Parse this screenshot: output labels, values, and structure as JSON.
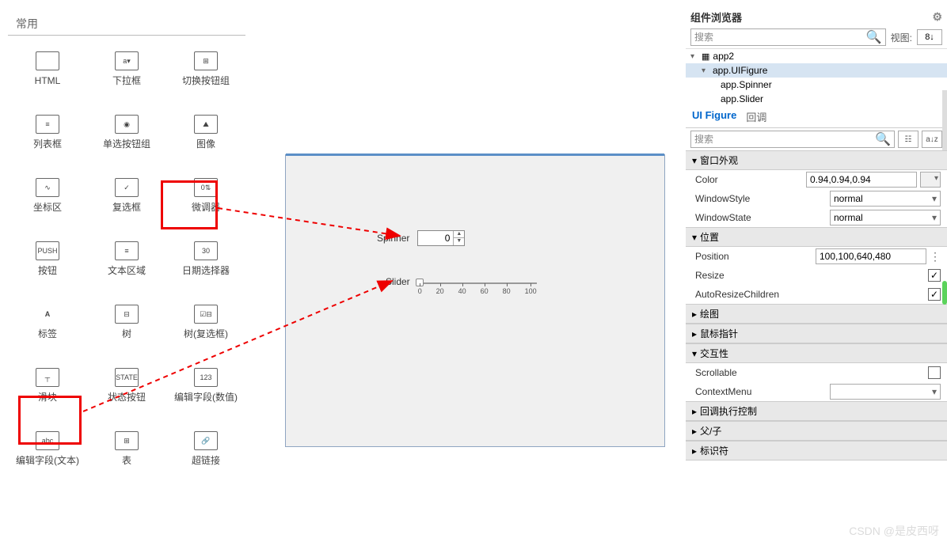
{
  "palette": {
    "header": "常用",
    "items": [
      {
        "label": "HTML",
        "icon": "</>"
      },
      {
        "label": "下拉框",
        "icon": "a▾"
      },
      {
        "label": "切换按钮组",
        "icon": "⊞"
      },
      {
        "label": "列表框",
        "icon": "≡"
      },
      {
        "label": "单选按钮组",
        "icon": "◉"
      },
      {
        "label": "图像",
        "icon": "⛰"
      },
      {
        "label": "坐标区",
        "icon": "∿"
      },
      {
        "label": "复选框",
        "icon": "✓"
      },
      {
        "label": "微调器",
        "icon": "0⇅"
      },
      {
        "label": "按钮",
        "icon": "PUSH"
      },
      {
        "label": "文本区域",
        "icon": "≡"
      },
      {
        "label": "日期选择器",
        "icon": "30"
      },
      {
        "label": "标签",
        "icon": "A"
      },
      {
        "label": "树",
        "icon": "⊟"
      },
      {
        "label": "树(复选框)",
        "icon": "☑⊟"
      },
      {
        "label": "滑块",
        "icon": "┬"
      },
      {
        "label": "状态按钮",
        "icon": "STATE"
      },
      {
        "label": "编辑字段(数值)",
        "icon": "123"
      },
      {
        "label": "编辑字段(文本)",
        "icon": "abc"
      },
      {
        "label": "表",
        "icon": "⊞"
      },
      {
        "label": "超链接",
        "icon": "🔗"
      }
    ]
  },
  "canvas": {
    "spinner": {
      "label": "Spinner",
      "value": "0"
    },
    "slider": {
      "label": "Slider",
      "ticks": [
        "0",
        "20",
        "40",
        "60",
        "80",
        "100"
      ]
    }
  },
  "browser": {
    "title": "组件浏览器",
    "search_placeholder": "搜索",
    "view_label": "视图:",
    "view_value": "8↓",
    "tree": {
      "root": "app2",
      "items": [
        "app.UIFigure",
        "app.Spinner",
        "app.Slider"
      ]
    },
    "tabs": {
      "uifigure": "UI Figure",
      "callback": "回调"
    },
    "prop_search_placeholder": "搜索",
    "sections": {
      "window": "窗口外观",
      "position": "位置",
      "plot": "绘图",
      "pointer": "鼠标指针",
      "interact": "交互性",
      "callback_ctrl": "回调执行控制",
      "parent": "父/子",
      "ident": "标识符"
    },
    "props": {
      "color": {
        "name": "Color",
        "value": "0.94,0.94,0.94"
      },
      "winstyle": {
        "name": "WindowStyle",
        "value": "normal"
      },
      "winstate": {
        "name": "WindowState",
        "value": "normal"
      },
      "position": {
        "name": "Position",
        "value": "100,100,640,480"
      },
      "resize": {
        "name": "Resize",
        "checked": true
      },
      "auto": {
        "name": "AutoResizeChildren",
        "checked": true
      },
      "scroll": {
        "name": "Scrollable",
        "checked": false
      },
      "ctx": {
        "name": "ContextMenu",
        "value": ""
      }
    }
  },
  "watermark": "CSDN @是皮西呀"
}
